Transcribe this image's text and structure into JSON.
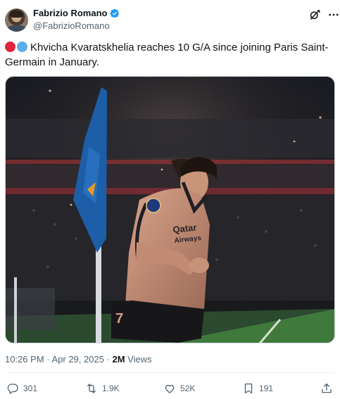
{
  "author": {
    "display_name": "Fabrizio Romano",
    "handle": "@FabrizioRomano"
  },
  "tweet": {
    "text": "Khvicha Kvaratskhelia reaches 10 G/A since joining Paris Saint-Germain in January.",
    "emoji": [
      "red-circle",
      "blue-circle"
    ],
    "timestamp": "10:26 PM · Apr 29, 2025",
    "separator": " · ",
    "views_count": "2M",
    "views_label": " Views"
  },
  "media": {
    "jersey_text": "Qatar Airways",
    "jersey_number": "7"
  },
  "stats": {
    "replies": "301",
    "reposts": "1.9K",
    "likes": "52K",
    "bookmarks": "191"
  },
  "colors": {
    "accent": "#1d9bf0",
    "text_primary": "#0f1419",
    "text_secondary": "#536471",
    "verified": "#1d9bf0",
    "psg_red": "#e0253e",
    "psg_blue": "#5cadec"
  },
  "icons": [
    "verified-icon",
    "grok-icon",
    "more-icon",
    "reply-icon",
    "repost-icon",
    "like-icon",
    "bookmark-icon",
    "share-icon"
  ]
}
